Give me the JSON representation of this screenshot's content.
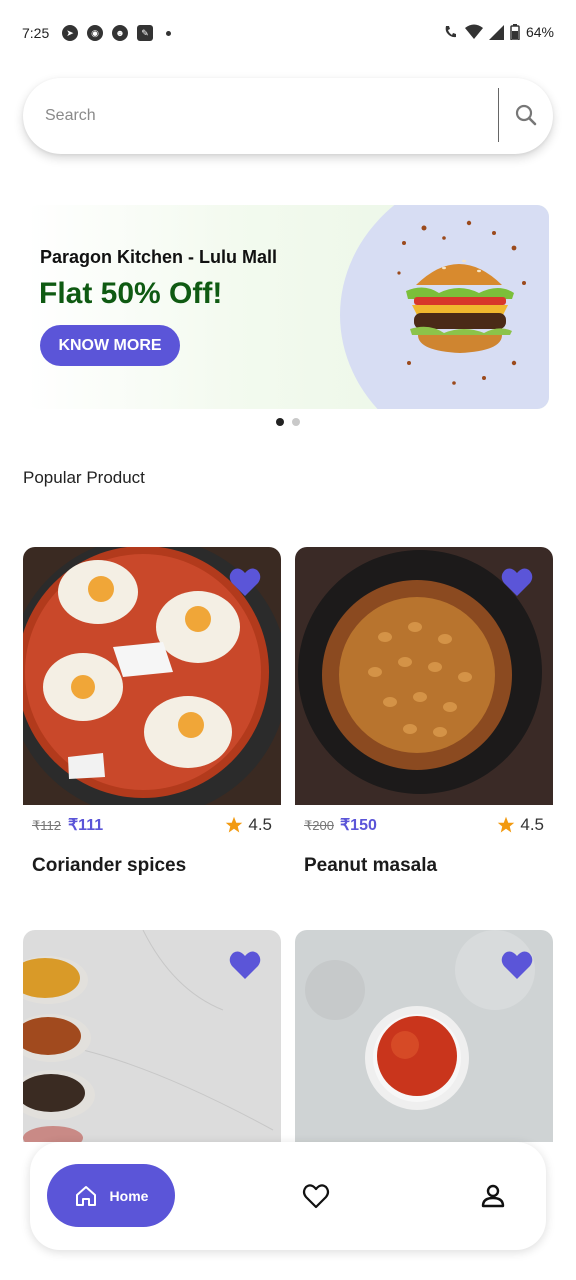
{
  "status_bar": {
    "time": "7:25",
    "battery": "64%",
    "left_icons": [
      "telegram-icon",
      "discord-icon",
      "reddit-icon",
      "notification-icon"
    ],
    "right_icons": [
      "call-icon",
      "wifi-icon",
      "signal-icon",
      "battery-icon"
    ]
  },
  "search": {
    "placeholder": "Search"
  },
  "banner": {
    "subtitle": "Paragon Kitchen - Lulu Mall",
    "title": "Flat 50% Off!",
    "button_label": "KNOW MORE",
    "active_slide": 1,
    "slide_count": 2
  },
  "section": {
    "title": "Popular Product"
  },
  "products": [
    {
      "name": "Coriander spices",
      "old_price": "₹112",
      "price": "₹111",
      "rating": "4.5",
      "favorite": true
    },
    {
      "name": "Peanut masala",
      "old_price": "₹200",
      "price": "₹150",
      "rating": "4.5",
      "favorite": true
    },
    {
      "name": "",
      "old_price": "",
      "price": "",
      "rating": "",
      "favorite": true
    },
    {
      "name": "",
      "old_price": "",
      "price": "",
      "rating": "",
      "favorite": true
    }
  ],
  "nav": {
    "home_label": "Home"
  },
  "colors": {
    "accent": "#5b55d8",
    "banner_title": "#0f5a12",
    "star": "#f29a11"
  }
}
